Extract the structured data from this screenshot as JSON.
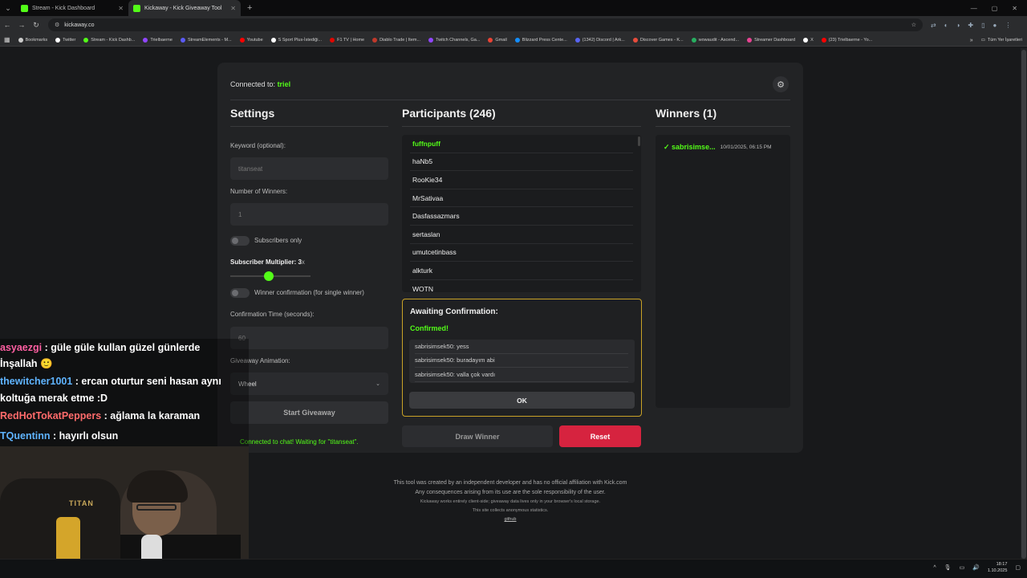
{
  "browser": {
    "tabs": [
      {
        "label": "Stream - Kick Dashboard",
        "active": false
      },
      {
        "label": "Kickaway - Kick Giveaway Tool",
        "active": true
      }
    ],
    "url": "kickaway.co",
    "bookmarks": [
      {
        "label": "Bookmarks",
        "color": "#cccccc"
      },
      {
        "label": "Twitter",
        "color": "#ffffff"
      },
      {
        "label": "Stream - Kick Dashb...",
        "color": "#53fc18"
      },
      {
        "label": "Trielbaerne",
        "color": "#9146ff"
      },
      {
        "label": "StreamElements - M...",
        "color": "#5b5bf5"
      },
      {
        "label": "Youtube",
        "color": "#ff0000"
      },
      {
        "label": "S Sport Plus-İstediği...",
        "color": "#ffffff"
      },
      {
        "label": "F1 TV | Home",
        "color": "#e10600"
      },
      {
        "label": "Diablo Trade | Item...",
        "color": "#c0392b"
      },
      {
        "label": "Twitch Channels, Ga...",
        "color": "#9146ff"
      },
      {
        "label": "Gmail",
        "color": "#ea4335"
      },
      {
        "label": "Blizzard Press Cente...",
        "color": "#148eff"
      },
      {
        "label": "(1342) Discord | Ark...",
        "color": "#5865f2"
      },
      {
        "label": "Discover Games - K...",
        "color": "#e74c3c"
      },
      {
        "label": "wowaudit - Ascend...",
        "color": "#27ae60"
      },
      {
        "label": "Streamer Dashboard",
        "color": "#e84393"
      },
      {
        "label": "X",
        "color": "#ffffff"
      },
      {
        "label": "(23) Trielbaerne - Yo...",
        "color": "#ff0000"
      }
    ],
    "bookmarks_right": "Tüm Yer İşaretleri"
  },
  "app": {
    "connected_label": "Connected to:",
    "connected_user": "triel",
    "settings": {
      "title": "Settings",
      "keyword_label": "Keyword (optional):",
      "keyword_placeholder": "titanseat",
      "winners_label": "Number of Winners:",
      "winners_placeholder": "1",
      "subscribers_only_label": "Subscribers only",
      "subscribers_only": false,
      "multiplier_label": "Subscriber Multiplier: 3",
      "multiplier_suffix": "x",
      "multiplier_value": 3,
      "winner_confirmation_label": "Winner confirmation (for single winner)",
      "winner_confirmation": false,
      "confirmation_time_label": "Confirmation Time (seconds):",
      "confirmation_time_placeholder": "60",
      "animation_label": "Giveaway Animation:",
      "animation_value": "Wheel",
      "start_button": "Start Giveaway",
      "status_text": "Connected to chat! Waiting for \"titanseat\"."
    },
    "participants": {
      "title": "Participants (246)",
      "list": [
        "fuffnpuff",
        "haNb5",
        "RooKie34",
        "MrSativaa",
        "Dasfassazmars",
        "sertaslan",
        "umutcetinbass",
        "alkturk",
        "WOTN"
      ],
      "awaiting_title": "Awaiting Confirmation:",
      "awaiting_status": "Confirmed!",
      "messages": [
        "sabrisimsek50: yess",
        "sabrisimsek50: buradayım abi",
        "sabrisimsek50: valla çok vardı"
      ],
      "ok_button": "OK",
      "draw_button": "Draw Winner",
      "reset_button": "Reset"
    },
    "winners": {
      "title": "Winners (1)",
      "list": [
        {
          "name": "✓ sabrisimse...",
          "date": "10/01/2025, 06:15 PM"
        }
      ]
    },
    "footer": {
      "line1": "This tool was created by an independent developer and has no official affiliation with Kick.com",
      "line2": "Any consequences arising from its use are the sole responsibility of the user.",
      "line3": "Kickaway works entirely client-side; giveaway data lives only in your browser's local storage.",
      "line4": "This site collects anonymous statistics.",
      "link": "github"
    }
  },
  "overlay": {
    "chat": [
      {
        "user": "asyaezgi",
        "text": " : güle güle kullan güzel günlerde",
        "color": "#ff5fa2"
      },
      {
        "user": "",
        "text": "İnşallah 🙂",
        "color": "#ffffff"
      },
      {
        "user": "thewitcher1001",
        "text": " : ercan oturtur seni hasan aynı",
        "color": "#5fb4ff"
      },
      {
        "user": "",
        "text": "koltuğa merak etme :D",
        "color": "#ffffff"
      },
      {
        "user": "RedHotTokatPeppers",
        "text": " : ağlama la karaman",
        "color": "#ff6b6b"
      },
      {
        "user": "TQuentinn",
        "text": " : hayırlı olsun",
        "color": "#5fb4ff"
      }
    ],
    "webcam_logo": "TITAN"
  },
  "taskbar": {
    "time": "18:17",
    "date": "1.10.2025"
  }
}
